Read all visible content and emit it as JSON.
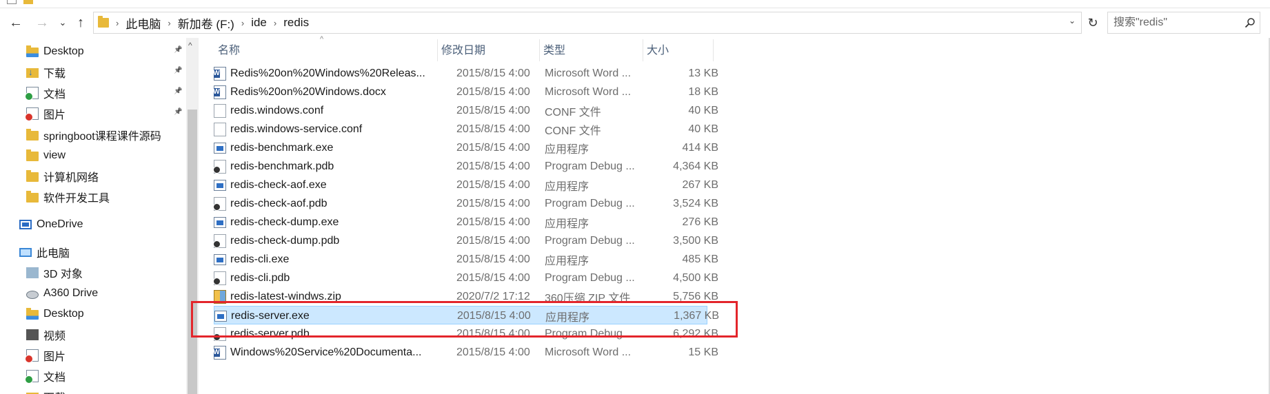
{
  "nav": {
    "back_icon": "back-arrow-icon",
    "forward_icon": "forward-arrow-icon",
    "recent_icon": "chevron-down-icon",
    "up_icon": "up-arrow-icon",
    "breadcrumb": [
      "此电脑",
      "新加卷 (F:)",
      "ide",
      "redis"
    ],
    "search_placeholder": "搜索\"redis\""
  },
  "sidebar": {
    "items": [
      {
        "label": "Desktop",
        "icon": "folder-desktop-icon",
        "pinned": true
      },
      {
        "label": "下载",
        "icon": "downloads-icon",
        "pinned": true
      },
      {
        "label": "文档",
        "icon": "documents-icon",
        "pinned": true
      },
      {
        "label": "图片",
        "icon": "pictures-icon",
        "pinned": true
      },
      {
        "label": "springboot课程课件源码",
        "icon": "folder-icon",
        "pinned": false
      },
      {
        "label": "view",
        "icon": "folder-icon",
        "pinned": false
      },
      {
        "label": "计算机网络",
        "icon": "folder-icon",
        "pinned": false
      },
      {
        "label": "软件开发工具",
        "icon": "folder-icon",
        "pinned": false
      },
      {
        "label": "OneDrive",
        "icon": "onedrive-icon",
        "pinned": false
      },
      {
        "label": "此电脑",
        "icon": "this-pc-icon",
        "pinned": false
      },
      {
        "label": "3D 对象",
        "icon": "3d-objects-icon",
        "pinned": false
      },
      {
        "label": "A360 Drive",
        "icon": "a360-drive-icon",
        "pinned": false
      },
      {
        "label": "Desktop",
        "icon": "folder-desktop-icon",
        "pinned": false
      },
      {
        "label": "视频",
        "icon": "videos-icon",
        "pinned": false
      },
      {
        "label": "图片",
        "icon": "pictures-icon",
        "pinned": false
      },
      {
        "label": "文档",
        "icon": "documents-icon",
        "pinned": false
      },
      {
        "label": "下载",
        "icon": "downloads-icon",
        "pinned": false
      }
    ]
  },
  "columns": {
    "name": "名称",
    "date": "修改日期",
    "type": "类型",
    "size": "大小"
  },
  "files": [
    {
      "name": "Redis%20on%20Windows%20Releas...",
      "date": "2015/8/15 4:00",
      "type": "Microsoft Word ...",
      "size": "13 KB",
      "icon": "word-doc-icon"
    },
    {
      "name": "Redis%20on%20Windows.docx",
      "date": "2015/8/15 4:00",
      "type": "Microsoft Word ...",
      "size": "18 KB",
      "icon": "word-doc-icon"
    },
    {
      "name": "redis.windows.conf",
      "date": "2015/8/15 4:00",
      "type": "CONF 文件",
      "size": "40 KB",
      "icon": "file-icon"
    },
    {
      "name": "redis.windows-service.conf",
      "date": "2015/8/15 4:00",
      "type": "CONF 文件",
      "size": "40 KB",
      "icon": "file-icon"
    },
    {
      "name": "redis-benchmark.exe",
      "date": "2015/8/15 4:00",
      "type": "应用程序",
      "size": "414 KB",
      "icon": "exe-icon"
    },
    {
      "name": "redis-benchmark.pdb",
      "date": "2015/8/15 4:00",
      "type": "Program Debug ...",
      "size": "4,364 KB",
      "icon": "pdb-icon"
    },
    {
      "name": "redis-check-aof.exe",
      "date": "2015/8/15 4:00",
      "type": "应用程序",
      "size": "267 KB",
      "icon": "exe-icon"
    },
    {
      "name": "redis-check-aof.pdb",
      "date": "2015/8/15 4:00",
      "type": "Program Debug ...",
      "size": "3,524 KB",
      "icon": "pdb-icon"
    },
    {
      "name": "redis-check-dump.exe",
      "date": "2015/8/15 4:00",
      "type": "应用程序",
      "size": "276 KB",
      "icon": "exe-icon"
    },
    {
      "name": "redis-check-dump.pdb",
      "date": "2015/8/15 4:00",
      "type": "Program Debug ...",
      "size": "3,500 KB",
      "icon": "pdb-icon"
    },
    {
      "name": "redis-cli.exe",
      "date": "2015/8/15 4:00",
      "type": "应用程序",
      "size": "485 KB",
      "icon": "exe-icon"
    },
    {
      "name": "redis-cli.pdb",
      "date": "2015/8/15 4:00",
      "type": "Program Debug ...",
      "size": "4,500 KB",
      "icon": "pdb-icon"
    },
    {
      "name": "redis-latest-windws.zip",
      "date": "2020/7/2 17:12",
      "type": "360压缩 ZIP 文件",
      "size": "5,756 KB",
      "icon": "zip-icon"
    },
    {
      "name": "redis-server.exe",
      "date": "2015/8/15 4:00",
      "type": "应用程序",
      "size": "1,367 KB",
      "icon": "exe-icon",
      "selected": true
    },
    {
      "name": "redis-server.pdb",
      "date": "2015/8/15 4:00",
      "type": "Program Debug ...",
      "size": "6,292 KB",
      "icon": "pdb-icon"
    },
    {
      "name": "Windows%20Service%20Documenta...",
      "date": "2015/8/15 4:00",
      "type": "Microsoft Word ...",
      "size": "15 KB",
      "icon": "word-doc-icon"
    }
  ],
  "colors": {
    "selection": "#cce8ff",
    "highlight": "#e3252b",
    "folder": "#e8b93a"
  }
}
